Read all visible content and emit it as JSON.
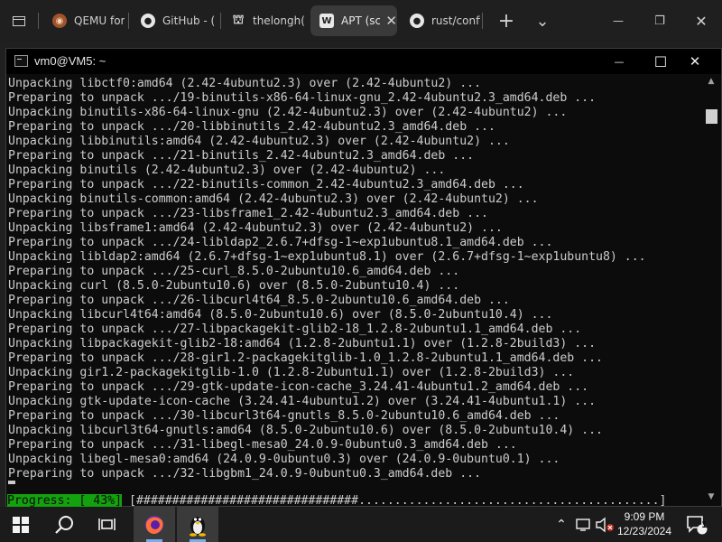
{
  "browser": {
    "tabs": [
      {
        "label": "QEMU for",
        "icon": "qemu-icon",
        "active": false
      },
      {
        "label": "GitHub - (",
        "icon": "github-icon",
        "active": false
      },
      {
        "label": "thelongh(",
        "icon": "bank-icon",
        "active": false
      },
      {
        "label": "APT (sc",
        "icon": "wikipedia-icon",
        "active": true,
        "close": "✕"
      },
      {
        "label": "rust/confi",
        "icon": "github-icon",
        "active": false
      }
    ],
    "new_tab": "+",
    "tab_list": "⌄",
    "minimize": "—",
    "restore": "❐",
    "close": "✕"
  },
  "terminal": {
    "title": "vm0@VM5: ~",
    "minimize": "—",
    "maximize": "☐",
    "close": "✕",
    "lines": [
      "Unpacking libctf0:amd64 (2.42-4ubuntu2.3) over (2.42-4ubuntu2) ...",
      "Preparing to unpack .../19-binutils-x86-64-linux-gnu_2.42-4ubuntu2.3_amd64.deb ...",
      "Unpacking binutils-x86-64-linux-gnu (2.42-4ubuntu2.3) over (2.42-4ubuntu2) ...",
      "Preparing to unpack .../20-libbinutils_2.42-4ubuntu2.3_amd64.deb ...",
      "Unpacking libbinutils:amd64 (2.42-4ubuntu2.3) over (2.42-4ubuntu2) ...",
      "Preparing to unpack .../21-binutils_2.42-4ubuntu2.3_amd64.deb ...",
      "Unpacking binutils (2.42-4ubuntu2.3) over (2.42-4ubuntu2) ...",
      "Preparing to unpack .../22-binutils-common_2.42-4ubuntu2.3_amd64.deb ...",
      "Unpacking binutils-common:amd64 (2.42-4ubuntu2.3) over (2.42-4ubuntu2) ...",
      "Preparing to unpack .../23-libsframe1_2.42-4ubuntu2.3_amd64.deb ...",
      "Unpacking libsframe1:amd64 (2.42-4ubuntu2.3) over (2.42-4ubuntu2) ...",
      "Preparing to unpack .../24-libldap2_2.6.7+dfsg-1~exp1ubuntu8.1_amd64.deb ...",
      "Unpacking libldap2:amd64 (2.6.7+dfsg-1~exp1ubuntu8.1) over (2.6.7+dfsg-1~exp1ubuntu8) ...",
      "Preparing to unpack .../25-curl_8.5.0-2ubuntu10.6_amd64.deb ...",
      "Unpacking curl (8.5.0-2ubuntu10.6) over (8.5.0-2ubuntu10.4) ...",
      "Preparing to unpack .../26-libcurl4t64_8.5.0-2ubuntu10.6_amd64.deb ...",
      "Unpacking libcurl4t64:amd64 (8.5.0-2ubuntu10.6) over (8.5.0-2ubuntu10.4) ...",
      "Preparing to unpack .../27-libpackagekit-glib2-18_1.2.8-2ubuntu1.1_amd64.deb ...",
      "Unpacking libpackagekit-glib2-18:amd64 (1.2.8-2ubuntu1.1) over (1.2.8-2build3) ...",
      "Preparing to unpack .../28-gir1.2-packagekitglib-1.0_1.2.8-2ubuntu1.1_amd64.deb ...",
      "Unpacking gir1.2-packagekitglib-1.0 (1.2.8-2ubuntu1.1) over (1.2.8-2build3) ...",
      "Preparing to unpack .../29-gtk-update-icon-cache_3.24.41-4ubuntu1.2_amd64.deb ...",
      "Unpacking gtk-update-icon-cache (3.24.41-4ubuntu1.2) over (3.24.41-4ubuntu1.1) ...",
      "Preparing to unpack .../30-libcurl3t64-gnutls_8.5.0-2ubuntu10.6_amd64.deb ...",
      "Unpacking libcurl3t64-gnutls:amd64 (8.5.0-2ubuntu10.6) over (8.5.0-2ubuntu10.4) ...",
      "Preparing to unpack .../31-libegl-mesa0_24.0.9-0ubuntu0.3_amd64.deb ...",
      "Unpacking libegl-mesa0:amd64 (24.0.9-0ubuntu0.3) over (24.0.9-0ubuntu0.1) ...",
      "Preparing to unpack .../32-libgbm1_24.0.9-0ubuntu0.3_amd64.deb ..."
    ],
    "progress_label": "Progress: [ 43%]",
    "progress_percent": 43,
    "progress_bar": "[###############################..........................................]"
  },
  "taskbar": {
    "apps": [
      {
        "name": "start-button",
        "icon": "windows-icon"
      },
      {
        "name": "search-button",
        "icon": "search-icon"
      },
      {
        "name": "task-view-button",
        "icon": "task-view-icon"
      },
      {
        "name": "firefox-button",
        "icon": "firefox-icon",
        "active": true
      },
      {
        "name": "linux-terminal-button",
        "icon": "tux-icon",
        "active": true
      }
    ],
    "time": "9:09 PM",
    "date": "12/23/2024",
    "notification_count": "1",
    "accent": "#7aaeea"
  },
  "colors": {
    "terminal_bg": "#0c0c0c",
    "terminal_fg": "#cccccc",
    "progress_green": "#13a10e"
  }
}
